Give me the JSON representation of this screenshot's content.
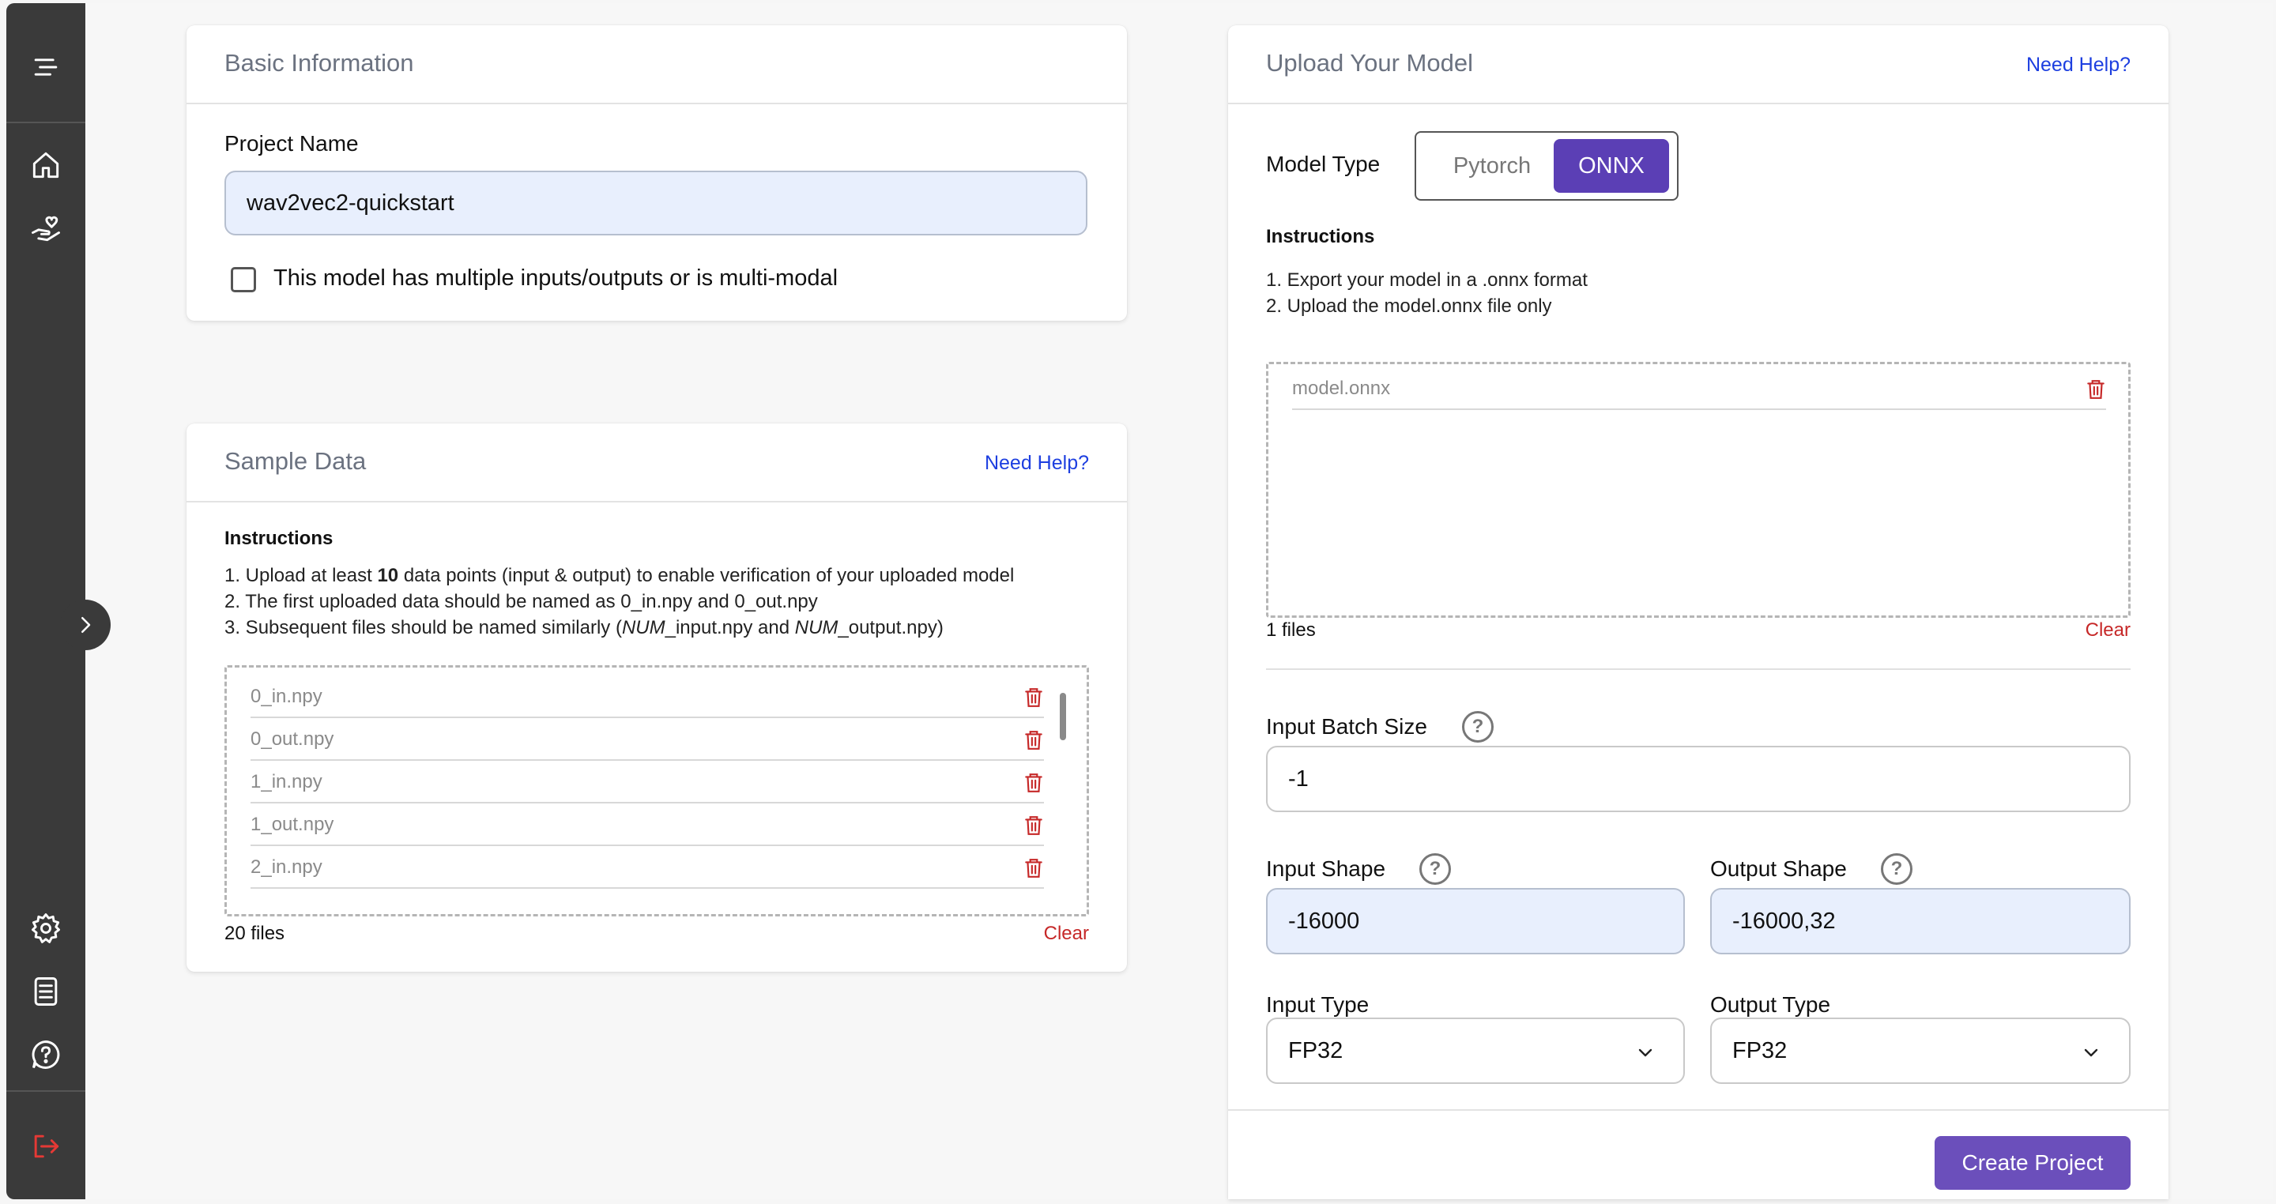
{
  "colors": {
    "sidebar": "#3a3a3a",
    "accent": "#6b4fbb",
    "link": "#1d3fe0",
    "danger": "#c62828",
    "input_filled": "#e8effd"
  },
  "sidebar": {
    "icons": [
      "menu-icon",
      "home-icon",
      "hand-heart-icon",
      "gear-icon",
      "document-icon",
      "help-icon",
      "logout-icon"
    ]
  },
  "basic_info": {
    "title": "Basic Information",
    "project_name_label": "Project Name",
    "project_name_value": "wav2vec2-quickstart",
    "multi_modal_label": "This model has multiple inputs/outputs or is multi-modal",
    "multi_modal_checked": false
  },
  "sample_data": {
    "title": "Sample Data",
    "help": "Need Help?",
    "instructions_title": "Instructions",
    "instr1_a": "1. Upload at least ",
    "instr1_b": "10",
    "instr1_c": " data points (input & output) to enable verification of your uploaded model",
    "instr2": "2. The first uploaded data should be named as 0_in.npy and 0_out.npy",
    "instr3_a": "3. Subsequent files should be named similarly (",
    "instr3_b": "NUM",
    "instr3_c": "_input.npy and ",
    "instr3_d": "NUM",
    "instr3_e": "_output.npy)",
    "files": [
      "0_in.npy",
      "0_out.npy",
      "1_in.npy",
      "1_out.npy",
      "2_in.npy"
    ],
    "file_count": "20 files",
    "clear": "Clear"
  },
  "upload_model": {
    "title": "Upload Your Model",
    "help": "Need Help?",
    "model_type_label": "Model Type",
    "model_type_options": [
      "Pytorch",
      "ONNX"
    ],
    "model_type_selected": "ONNX",
    "instructions_title": "Instructions",
    "instr1": "1. Export your model in a .onnx format",
    "instr2": "2. Upload the model.onnx file only",
    "files": [
      "model.onnx"
    ],
    "file_count": "1 files",
    "clear": "Clear",
    "batch_size_label": "Input Batch Size",
    "batch_size_value": "-1",
    "input_shape_label": "Input Shape",
    "input_shape_value": "-16000",
    "output_shape_label": "Output Shape",
    "output_shape_value": "-16000,32",
    "input_type_label": "Input Type",
    "input_type_value": "FP32",
    "output_type_label": "Output Type",
    "output_type_value": "FP32",
    "help_glyph": "?",
    "create_button": "Create Project"
  }
}
